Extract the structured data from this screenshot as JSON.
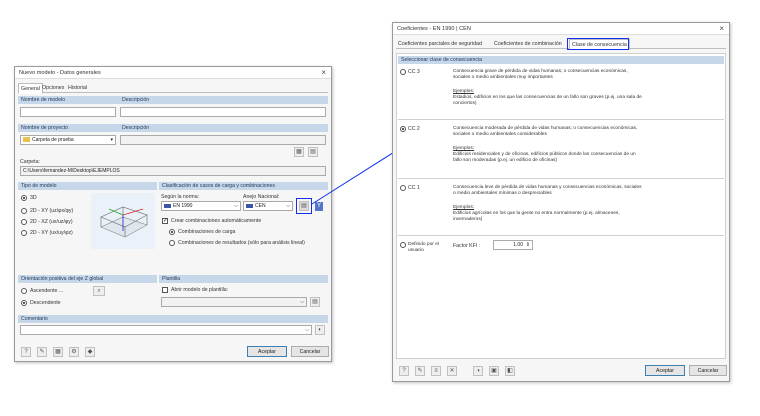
{
  "left_dialog": {
    "title": "Nuevo modelo - Datos generales",
    "tabs": [
      "General",
      "Opciones",
      "Historial"
    ],
    "model_name_label": "Nombre de modelo",
    "description_label": "Descripción",
    "project_name_label": "Nombre de proyecto",
    "project_description_label": "Descripción",
    "project_value": "Carpeta de prueba",
    "folder_label": "Carpeta:",
    "folder_value": "C:\\Users\\fernandez-M\\Desktop\\EJEMPLOS",
    "model_type_section": "Tipo de modelo",
    "model_types": [
      "3D",
      "2D - XY (uz/φx/φy)",
      "2D - XZ (ux/uz/φy)",
      "2D - XY (ux/uy/φz)"
    ],
    "classification_section": "Clasificación de casos de carga y combinaciones",
    "standard_label": "Según la norma:",
    "standard_value": "EN 1990",
    "annex_label": "Anejo Nacional:",
    "annex_value": "CEN",
    "auto_combinations_label": "Crear combinaciones automáticamente",
    "combo_options": [
      "Combinaciones de carga",
      "Combinaciones de resultados (sólo para análisis lineal)"
    ],
    "orientation_section": "Orientación positiva del eje Z global",
    "orientation_options": [
      "Ascendente ...",
      "Descendente"
    ],
    "template_section": "Plantilla",
    "open_template_label": "Abrir modelo de plantilla:",
    "comment_section": "Comentario",
    "accept_label": "Aceptar",
    "cancel_label": "Cancelar"
  },
  "right_dialog": {
    "title": "Coeficientes - EN 1990 | CEN",
    "tabs": [
      "Coeficientes parciales de seguridad",
      "Coeficientes de combinación",
      "Clase de consecuencia"
    ],
    "section_title": "Seleccionar clase de consecuencia",
    "classes": [
      {
        "label": "CC 3",
        "desc": "Consecuencia grave de pérdida de vidas humanas; o consecuencias económicas, sociales o medio ambientales muy importantes",
        "examples_label": "Ejemplos:",
        "examples": "Estadios, edificios en los que las consecuencias de un fallo son graves (p.ej. una sala de conciertos)"
      },
      {
        "label": "CC 2",
        "desc": "Consecuencia moderada de pérdida de vidas humanas; o consecuencias económicas, sociales o medio ambientales considerables",
        "examples_label": "Ejemplos:",
        "examples": "Edificios residenciales y de oficinas, edificios públicos donde las consecuencias de un fallo son moderadas (p.ej. un edificio de oficinas)"
      },
      {
        "label": "CC 1",
        "desc": "Consecuencia leve de pérdida de vidas humanas y consecuencias económicas, sociales o medio ambientales mínimas o despreciables",
        "examples_label": "Ejemplos:",
        "examples": "Edificios agrícolas en los que la gente no entra normalmente (p.ej. almacenes, invernaderos)"
      }
    ],
    "user_defined_label": "Definido por el usuario",
    "factor_label": "Factor KFI :",
    "factor_value": "1.00",
    "accept_label": "Aceptar",
    "cancel_label": "Cancelar"
  },
  "colors": {
    "section_header_bg": "#c6d7ea",
    "highlight": "#1133ee"
  }
}
